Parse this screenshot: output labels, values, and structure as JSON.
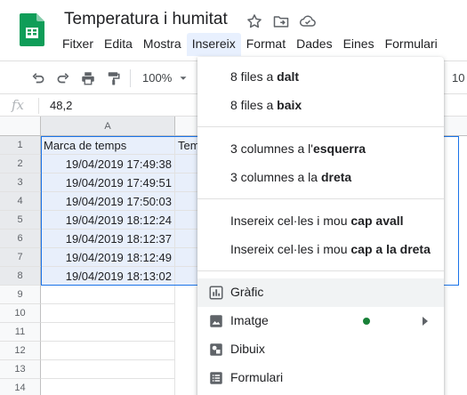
{
  "app": {
    "title": "Temperatura i humitat"
  },
  "menubar": [
    {
      "label": "Fitxer"
    },
    {
      "label": "Edita"
    },
    {
      "label": "Mostra"
    },
    {
      "label": "Insereix"
    },
    {
      "label": "Format"
    },
    {
      "label": "Dades"
    },
    {
      "label": "Eines"
    },
    {
      "label": "Formulari"
    }
  ],
  "toolbar": {
    "zoom": "100%",
    "font_size_partial": "10"
  },
  "formula_bar": {
    "fx": "fx",
    "value": "48,2"
  },
  "grid": {
    "columns": [
      {
        "label": "A"
      }
    ],
    "rows": [
      {
        "num": "1",
        "a": "Marca de temps",
        "b": "Tem"
      },
      {
        "num": "2",
        "a": "19/04/2019 17:49:38"
      },
      {
        "num": "3",
        "a": "19/04/2019 17:49:51"
      },
      {
        "num": "4",
        "a": "19/04/2019 17:50:03"
      },
      {
        "num": "5",
        "a": "19/04/2019 18:12:24"
      },
      {
        "num": "6",
        "a": "19/04/2019 18:12:37"
      },
      {
        "num": "7",
        "a": "19/04/2019 18:12:49"
      },
      {
        "num": "8",
        "a": "19/04/2019 18:13:02"
      },
      {
        "num": "9"
      },
      {
        "num": "10"
      },
      {
        "num": "11"
      },
      {
        "num": "12"
      },
      {
        "num": "13"
      },
      {
        "num": "14"
      }
    ]
  },
  "insert_menu": {
    "rows_above": {
      "prefix": "8 files a ",
      "bold": "dalt"
    },
    "rows_below": {
      "prefix": "8 files a ",
      "bold": "baix"
    },
    "cols_left": {
      "prefix": "3 columnes a l'",
      "bold": "esquerra"
    },
    "cols_right": {
      "prefix": "3 columnes a la ",
      "bold": "dreta"
    },
    "cells_down": {
      "prefix": "Insereix cel·les i mou ",
      "bold": "cap avall"
    },
    "cells_right": {
      "prefix": "Insereix cel·les i mou ",
      "bold": "cap a la dreta"
    },
    "chart": "Gràfic",
    "image": "Imatge",
    "drawing": "Dibuix",
    "form": "Formulari"
  },
  "colors": {
    "accent": "#1a73e8",
    "sheets_green": "#0f9d58",
    "status_dot": "#188038"
  }
}
